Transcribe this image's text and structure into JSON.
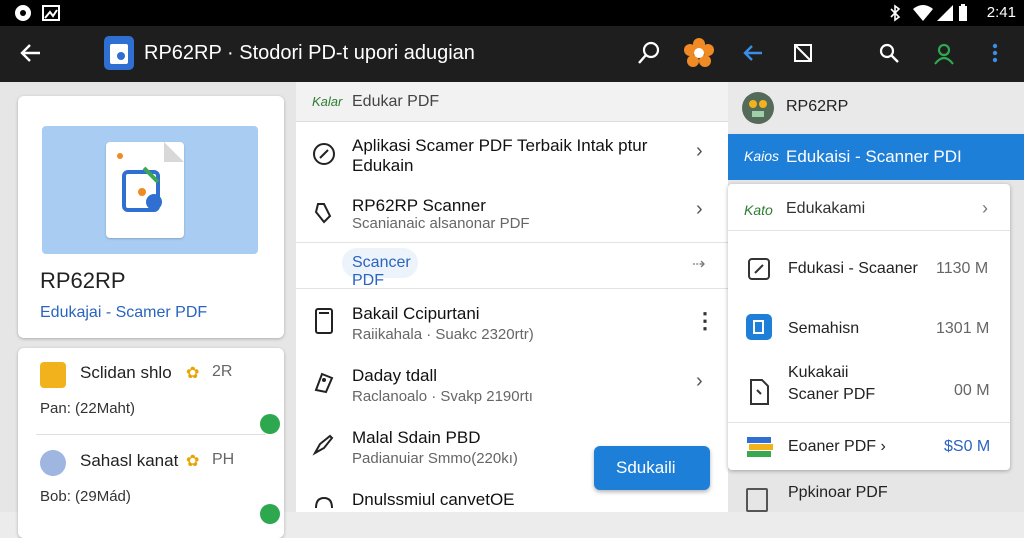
{
  "status_bar": {
    "time": "2:41"
  },
  "app_bar": {
    "title": "RP62RP · Stodori PD‑t upori adugian"
  },
  "left_pane": {
    "card_title": "RP62RP",
    "card_subtitle": "Edukajai - Scamer PDF",
    "stats": [
      {
        "title": "Sclidan shlo",
        "badge": "✿",
        "count": "2R",
        "value": "Pan: (22Maht)"
      },
      {
        "title": "Sahasl kanat",
        "badge": "✿",
        "count": "PH",
        "value": "Bob: (29Mád)"
      }
    ]
  },
  "middle_pane": {
    "header_label": "Kalar",
    "header_title": "Edukar PDF",
    "rows": [
      {
        "title": "Aplikasi Scamer PDF Terbaik Intak ptur",
        "title2": "Edukain"
      },
      {
        "title": "RP62RP Scanner",
        "subtitle": "Scanianaic alsanonar PDF"
      },
      {
        "title": "Bakail Ccipurtani",
        "subtitle": "Raiikahala · Suakc 2320rtr)"
      },
      {
        "title": "Daday tdall",
        "subtitle": "Raclanoalo · Svakp 2190rtı"
      },
      {
        "title": "Malal Sdain PBD",
        "subtitle": "Padianuiar Smmo(220kı)"
      },
      {
        "title": "Dnulssmiul canvetOE"
      }
    ],
    "chip_label": "Scancer PDF",
    "fab_label": "Sdukaili"
  },
  "right_pane": {
    "profile_name": "RP62RP",
    "selected_label": "Kaios",
    "selected_title": "Edukaisi - Scanner PDI",
    "card_header_label": "Kato",
    "card_header_title": "Edukakami",
    "files": [
      {
        "name": "Fdukasi - Scaaner",
        "size": "1130 M"
      },
      {
        "name": "Semahisn",
        "size": "1301 M"
      },
      {
        "name": "Kukakaii",
        "name2": "Scaner PDF",
        "size": "00 M"
      },
      {
        "name": "Eoaner PDF ›",
        "size": "$S0 M"
      }
    ],
    "bottom_title": "Ppkinoar PDF"
  }
}
